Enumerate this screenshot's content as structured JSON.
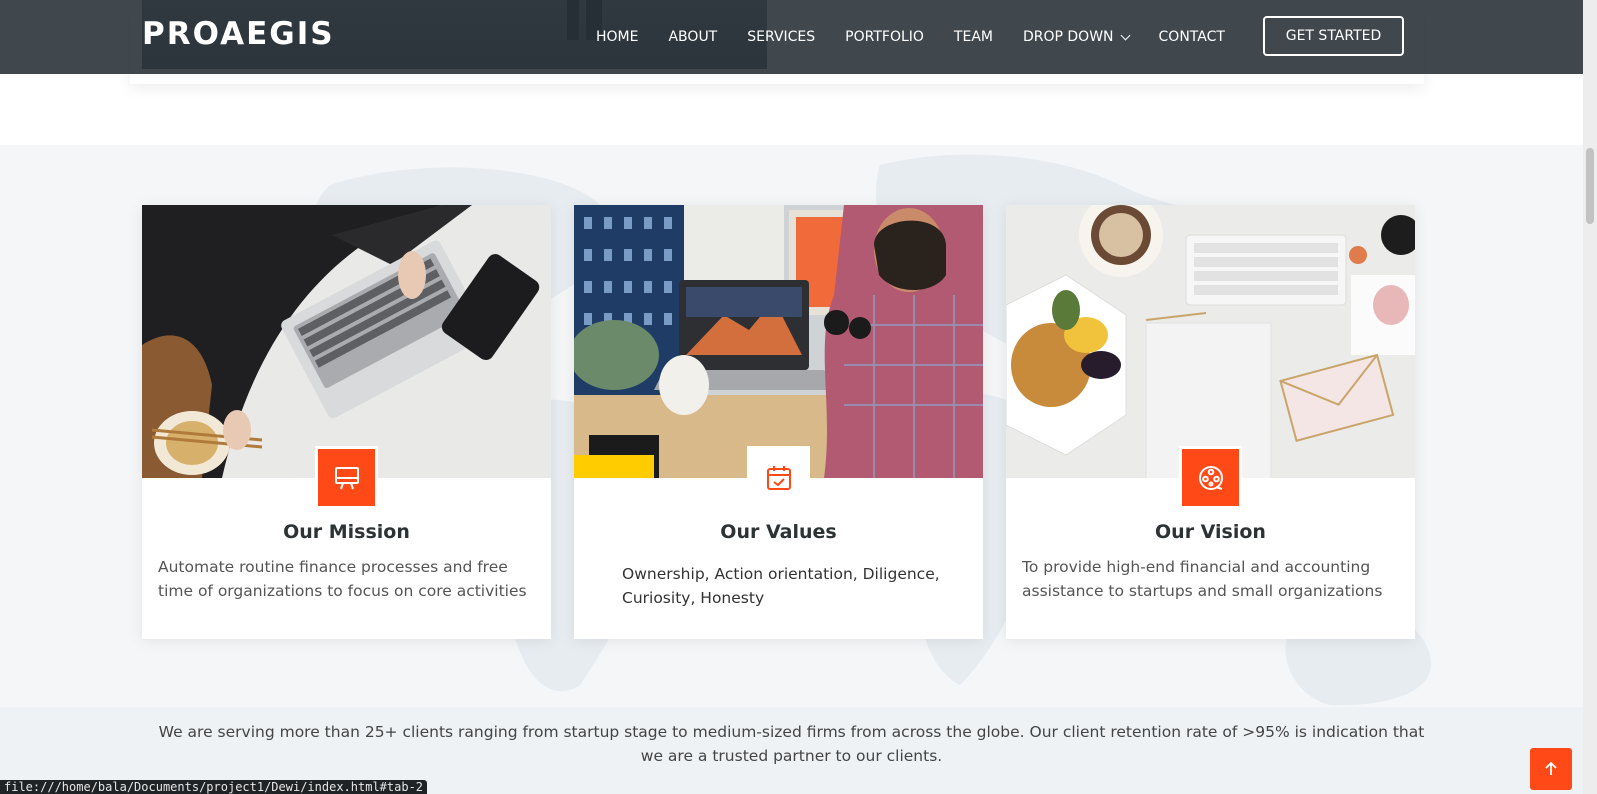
{
  "header": {
    "logo": "PROAEGIS",
    "nav": {
      "home": "HOME",
      "about": "ABOUT",
      "services": "SERVICES",
      "portfolio": "PORTFOLIO",
      "team": "TEAM",
      "dropdown": "DROP DOWN",
      "contact": "CONTACT"
    },
    "cta": "GET STARTED"
  },
  "cards": [
    {
      "title": "Our Mission",
      "text": "Automate routine finance processes and free time of organizations to focus on core activities",
      "icon": "easel-icon"
    },
    {
      "title": "Our Values",
      "text": "Ownership, Action orientation, Diligence, Curiosity, Honesty",
      "icon": "calendar-check-icon"
    },
    {
      "title": "Our Vision",
      "text": "To provide high-end financial and accounting assistance to startups and small organizations",
      "icon": "film-reel-icon"
    }
  ],
  "clients": {
    "text": "We are serving more than 25+ clients ranging from startup stage to medium-sized firms from across the globe. Our client retention rate of >95% is indication that we are a trusted partner to our clients."
  },
  "status_link": "file:///home/bala/Documents/project1/Dewi/index.html#tab-2",
  "colors": {
    "accent": "#ff4a17",
    "header_bg": "#262f35",
    "section_bg": "#f4f6f7"
  }
}
